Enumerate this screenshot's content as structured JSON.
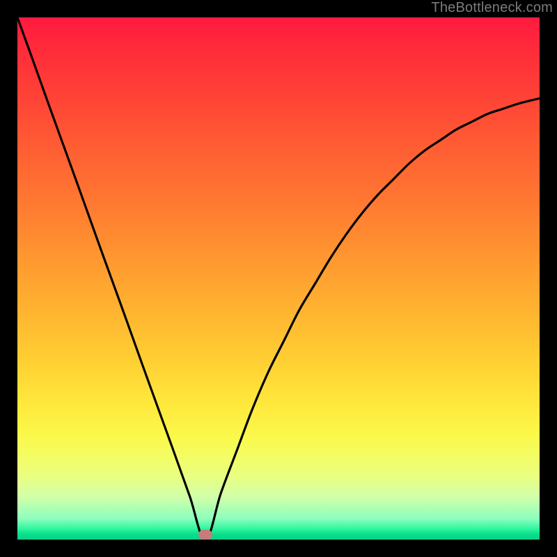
{
  "watermark": "TheBottleneck.com",
  "chart_data": {
    "type": "line",
    "title": "",
    "xlabel": "",
    "ylabel": "",
    "xlim": [
      0,
      100
    ],
    "ylim": [
      0,
      100
    ],
    "min_marker": {
      "x": 36,
      "y": 1
    },
    "x": [
      0,
      3,
      6,
      9,
      12,
      15,
      18,
      21,
      24,
      27,
      30,
      33,
      36,
      39,
      42,
      45,
      48,
      51,
      54,
      57,
      60,
      63,
      66,
      69,
      72,
      75,
      78,
      81,
      84,
      87,
      90,
      93,
      96,
      100
    ],
    "values": [
      100,
      91.7,
      83.3,
      75,
      66.7,
      58.3,
      50,
      41.7,
      33.3,
      25,
      16.7,
      8.3,
      0,
      9,
      17,
      25,
      32,
      38,
      44,
      49,
      54,
      58.5,
      62.5,
      66,
      69,
      72,
      74.5,
      76.5,
      78.5,
      80,
      81.5,
      82.5,
      83.5,
      84.5
    ],
    "series": [
      {
        "name": "bottleneck-curve",
        "values_ref": "values"
      }
    ],
    "gradient_stops": [
      {
        "pct": 0,
        "color": "#ff1a3f"
      },
      {
        "pct": 50,
        "color": "#ffb330"
      },
      {
        "pct": 80,
        "color": "#fbf84a"
      },
      {
        "pct": 100,
        "color": "#06d287"
      }
    ]
  }
}
